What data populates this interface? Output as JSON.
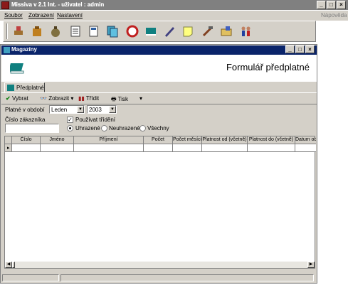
{
  "app": {
    "title": "Missiva v 2.1 Int. - uživatel : admin",
    "help": "Nápověda"
  },
  "menu": [
    "Soubor",
    "Zobrazení",
    "Nastavení"
  ],
  "toolbar_icons": [
    "stamp-icon",
    "bag-icon",
    "money-bag-icon",
    "checklist-icon",
    "document-icon",
    "copy-icon",
    "lifebuoy-icon",
    "book-icon",
    "pen-icon",
    "note-icon",
    "tools-icon",
    "folder-icon",
    "people-icon"
  ],
  "child": {
    "title": "Magazíny",
    "form_title": "Formulář předplatné"
  },
  "tab": {
    "label": "Předplatné"
  },
  "actions": {
    "select": "Vybrat",
    "view": "Zobrazit",
    "sort": "Třídit",
    "print": "Tisk"
  },
  "filters": {
    "period_label": "Platné v období",
    "month": "Leden",
    "year": "2003",
    "customer_label": "Číslo zákazníka",
    "customer_value": "",
    "use_sort_label": "Používat třídění",
    "paid_label": "Uhrazené",
    "unpaid_label": "Neuhrazené",
    "all_label": "Všechny",
    "selected_radio": "paid"
  },
  "grid": {
    "columns": [
      "Číslo",
      "Jméno",
      "Příjmení",
      "Počet",
      "Počet měsíců",
      "Platnost od (včetně)",
      "Platnost do (včetně)",
      "Datum ob"
    ]
  }
}
